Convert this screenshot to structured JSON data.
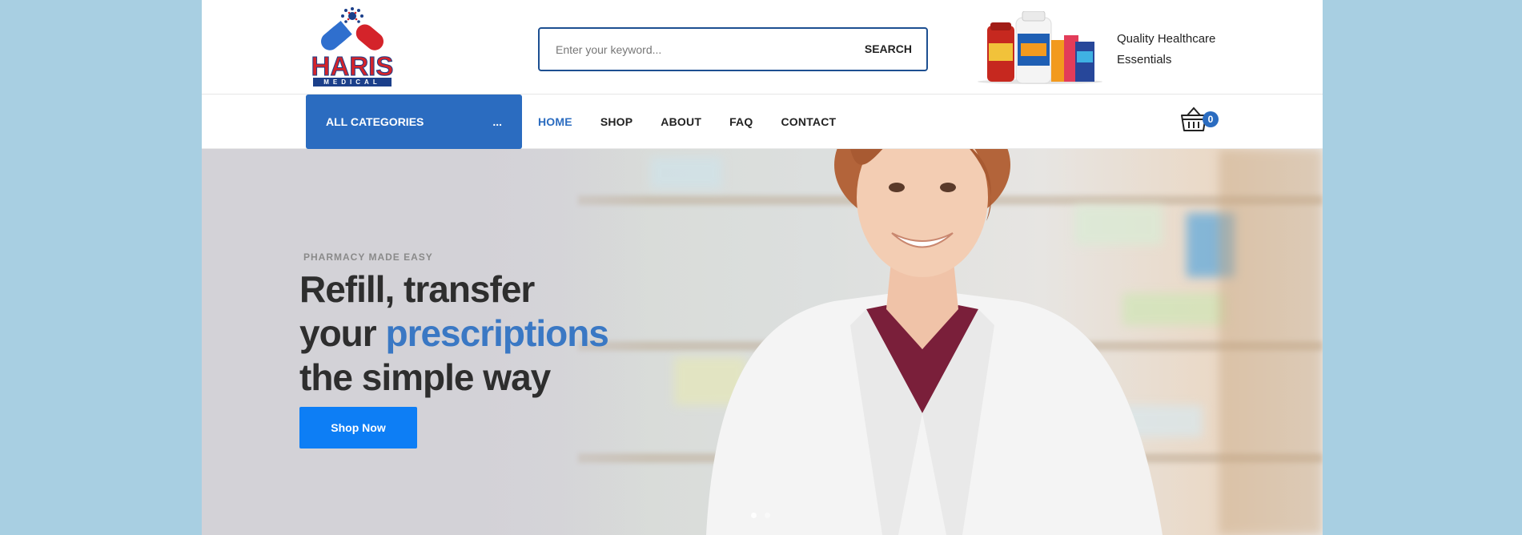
{
  "header": {
    "logo": {
      "name": "HARIS",
      "sub": "MEDICAL"
    },
    "search": {
      "placeholder": "Enter your keyword...",
      "button_label": "SEARCH"
    },
    "promo": {
      "line1": "Quality Healthcare",
      "line2": "Essentials"
    }
  },
  "nav": {
    "categories_label": "ALL CATEGORIES",
    "categories_more": "...",
    "items": [
      {
        "label": "HOME",
        "active": true
      },
      {
        "label": "SHOP",
        "active": false
      },
      {
        "label": "ABOUT",
        "active": false
      },
      {
        "label": "FAQ",
        "active": false
      },
      {
        "label": "CONTACT",
        "active": false
      }
    ],
    "cart_count": "0",
    "cart_icon": "basket-icon"
  },
  "hero": {
    "kicker": "PHARMACY MADE EASY",
    "title_line1": "Refill, transfer",
    "title_line2_a": "your ",
    "title_line2_b": "prescriptions",
    "title_line3": "the simple way",
    "button_label": "Shop Now",
    "slide_count": 2,
    "active_slide": 1
  },
  "colors": {
    "accent": "#2b6cc0",
    "button_blue": "#0d7ef5",
    "highlight": "#3a78c4",
    "page_bg": "#a8cfe2",
    "logo_red": "#d4232a",
    "logo_blue": "#1b3f8a"
  }
}
